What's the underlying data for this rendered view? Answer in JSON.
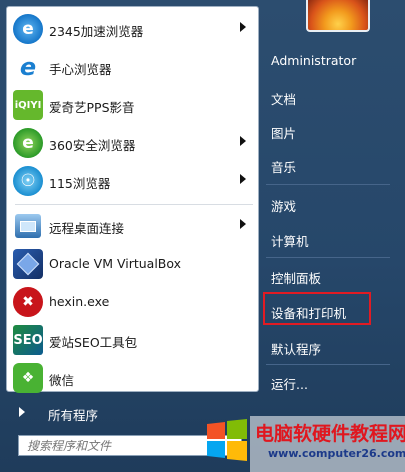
{
  "programs": [
    {
      "label": "2345加速浏览器",
      "icon": "2345-browser-icon",
      "has_arrow": true
    },
    {
      "label": "手心浏览器",
      "icon": "shouxin-browser-icon",
      "has_arrow": false
    },
    {
      "label": "爱奇艺PPS影音",
      "icon": "iqiyi-pps-icon",
      "has_arrow": false
    },
    {
      "label": "360安全浏览器",
      "icon": "360-browser-icon",
      "has_arrow": true
    },
    {
      "label": "115浏览器",
      "icon": "115-browser-icon",
      "has_arrow": true
    },
    {
      "label": "远程桌面连接",
      "icon": "remote-desktop-icon",
      "has_arrow": true
    },
    {
      "label": "Oracle VM VirtualBox",
      "icon": "virtualbox-icon",
      "has_arrow": false
    },
    {
      "label": "hexin.exe",
      "icon": "hexin-icon",
      "has_arrow": false
    },
    {
      "label": "爱站SEO工具包",
      "icon": "aizhan-seo-icon",
      "has_arrow": false
    },
    {
      "label": "微信",
      "icon": "wechat-icon",
      "has_arrow": false
    }
  ],
  "all_programs_label": "所有程序",
  "search_placeholder": "搜索程序和文件",
  "right_items": [
    {
      "label": "Administrator"
    },
    {
      "label": "文档"
    },
    {
      "label": "图片"
    },
    {
      "label": "音乐"
    },
    {
      "label": "游戏"
    },
    {
      "label": "计算机"
    },
    {
      "label": "控制面板"
    },
    {
      "label": "设备和打印机"
    },
    {
      "label": "默认程序"
    },
    {
      "label": "运行..."
    }
  ],
  "highlighted_item": "设备和打印机",
  "watermark": {
    "text": "电脑软硬件教程网",
    "url": "www.computer26.com"
  },
  "colors": {
    "menu_bg": "#26476a",
    "highlight": "#e21b23"
  }
}
